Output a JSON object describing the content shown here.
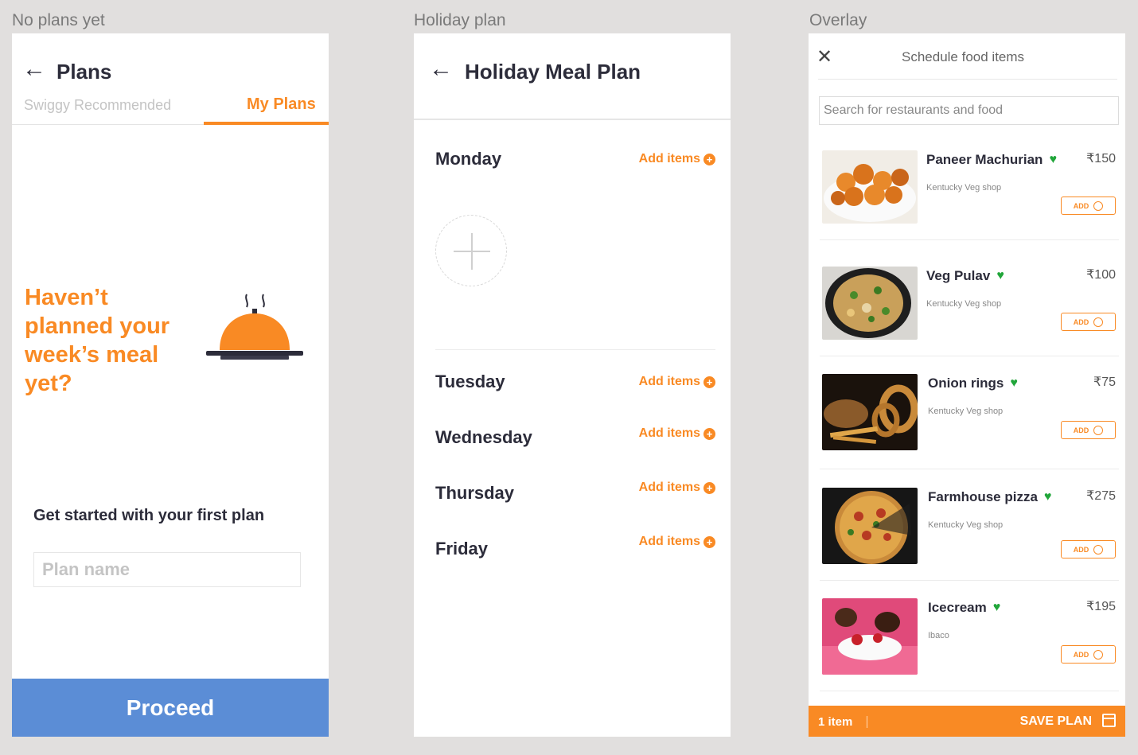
{
  "frames": {
    "no_plans_label": "No plans yet",
    "holiday_label": "Holiday plan",
    "overlay_label": "Overlay"
  },
  "plans_screen": {
    "back_icon": "back-arrow-icon",
    "title": "Plans",
    "tabs": [
      {
        "label": "Swiggy Recommended",
        "active": false
      },
      {
        "label": "My Plans",
        "active": true
      }
    ],
    "headline": "Haven’t planned your week’s meal yet?",
    "illustration_icon": "food-cloche-icon",
    "get_started": "Get started with your first plan",
    "plan_name_placeholder": "Plan name",
    "plan_name_value": "",
    "proceed_label": "Proceed"
  },
  "holiday_screen": {
    "back_icon": "back-arrow-icon",
    "title": "Holiday Meal Plan",
    "add_items_label": "Add items",
    "days": [
      "Monday",
      "Tuesday",
      "Wednesday",
      "Thursday",
      "Friday"
    ]
  },
  "overlay_screen": {
    "close_icon": "close-icon",
    "title": "Schedule food items",
    "search_placeholder": "Search for restaurants and food",
    "add_label": "ADD",
    "items": [
      {
        "name": "Paneer Machurian",
        "price": "₹150",
        "shop": "Kentucky Veg shop"
      },
      {
        "name": "Veg Pulav",
        "price": "₹100",
        "shop": "Kentucky Veg shop"
      },
      {
        "name": "Onion rings",
        "price": "₹75",
        "shop": "Kentucky Veg shop"
      },
      {
        "name": "Farmhouse pizza",
        "price": "₹275",
        "shop": "Kentucky Veg shop"
      },
      {
        "name": "Icecream",
        "price": "₹195",
        "shop": "Ibaco"
      }
    ],
    "bottom_bar": {
      "count": "1 item",
      "save_label": "SAVE PLAN",
      "calendar_icon": "calendar-icon"
    }
  },
  "colors": {
    "accent": "#f98a24",
    "proceed_blue": "#5b8dd6",
    "veg_green": "#21a63a",
    "text_dark": "#2c2c3a"
  }
}
